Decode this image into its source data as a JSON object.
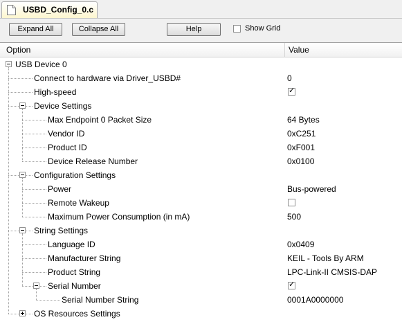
{
  "tab": {
    "label": "USBD_Config_0.c",
    "icon": "c-file-icon"
  },
  "toolbar": {
    "expand_all": "Expand All",
    "collapse_all": "Collapse All",
    "help": "Help",
    "show_grid": "Show Grid",
    "show_grid_checked": false
  },
  "grid": {
    "header": {
      "option": "Option",
      "value": "Value"
    },
    "rows": [
      {
        "label": "USB Device 0",
        "value": "",
        "level": 0,
        "expander": "collapse"
      },
      {
        "label": "Connect to hardware via Driver_USBD#",
        "value": "0",
        "level": 1
      },
      {
        "label": "High-speed",
        "value": "",
        "level": 1,
        "checkbox": true
      },
      {
        "label": "Device Settings",
        "value": "",
        "level": 1,
        "expander": "collapse"
      },
      {
        "label": "Max Endpoint 0 Packet Size",
        "value": "64 Bytes",
        "level": 2
      },
      {
        "label": "Vendor ID",
        "value": "0xC251",
        "level": 2
      },
      {
        "label": "Product ID",
        "value": "0xF001",
        "level": 2
      },
      {
        "label": "Device Release Number",
        "value": "0x0100",
        "level": 2
      },
      {
        "label": "Configuration Settings",
        "value": "",
        "level": 1,
        "expander": "collapse"
      },
      {
        "label": "Power",
        "value": "Bus-powered",
        "level": 2
      },
      {
        "label": "Remote Wakeup",
        "value": "",
        "level": 2,
        "checkbox": false
      },
      {
        "label": "Maximum Power Consumption (in mA)",
        "value": "500",
        "level": 2
      },
      {
        "label": "String Settings",
        "value": "",
        "level": 1,
        "expander": "collapse"
      },
      {
        "label": "Language ID",
        "value": "0x0409",
        "level": 2
      },
      {
        "label": "Manufacturer String",
        "value": "KEIL - Tools By ARM",
        "level": 2
      },
      {
        "label": "Product String",
        "value": "LPC-Link-II CMSIS-DAP",
        "level": 2
      },
      {
        "label": "Serial Number",
        "value": "",
        "level": 2,
        "checkbox": true,
        "expander": "collapse"
      },
      {
        "label": "Serial Number String",
        "value": "0001A0000000",
        "level": 3
      },
      {
        "label": "OS Resources Settings",
        "value": "",
        "level": 1,
        "expander": "expand"
      }
    ]
  }
}
